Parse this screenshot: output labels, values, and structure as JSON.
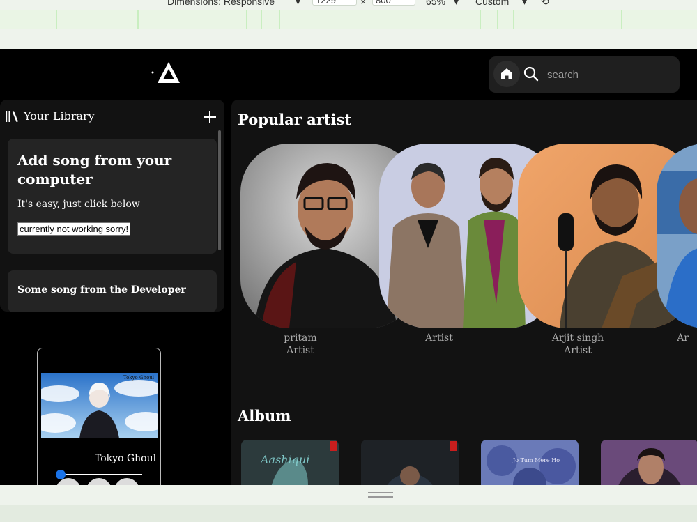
{
  "devtools": {
    "dimensions_label": "Dimensions: Responsive",
    "width_value": "1229",
    "height_value": "800",
    "zoom_label": "65%",
    "throttle_label": "Custom"
  },
  "header": {
    "search_placeholder": "search"
  },
  "library": {
    "title": "Your Library",
    "add_card": {
      "heading": "Add song from your computer",
      "subtext": "It's easy, just click below",
      "button_label": "currently not working sorry!"
    },
    "dev_card_title": "Some song from the Developer"
  },
  "player": {
    "art_caption": "Tokyo Ghoul",
    "track_title": "Tokyo Ghoul Ghoul"
  },
  "main": {
    "popular_title": "Popular artist",
    "album_title": "Album",
    "artists": [
      {
        "name": "pritam",
        "role": "Artist"
      },
      {
        "name": "",
        "role": "Artist"
      },
      {
        "name": "Arjit singh",
        "role": "Artist"
      },
      {
        "name": "",
        "role": "Ar"
      }
    ],
    "albums": [
      {
        "caption": "Aashiqui"
      },
      {
        "caption": ""
      },
      {
        "caption": "Jo Tum Mere Ho"
      },
      {
        "caption": ""
      }
    ]
  },
  "colors": {
    "accent_blue": "#1a73e8",
    "panel": "#121212",
    "card": "#242424"
  }
}
